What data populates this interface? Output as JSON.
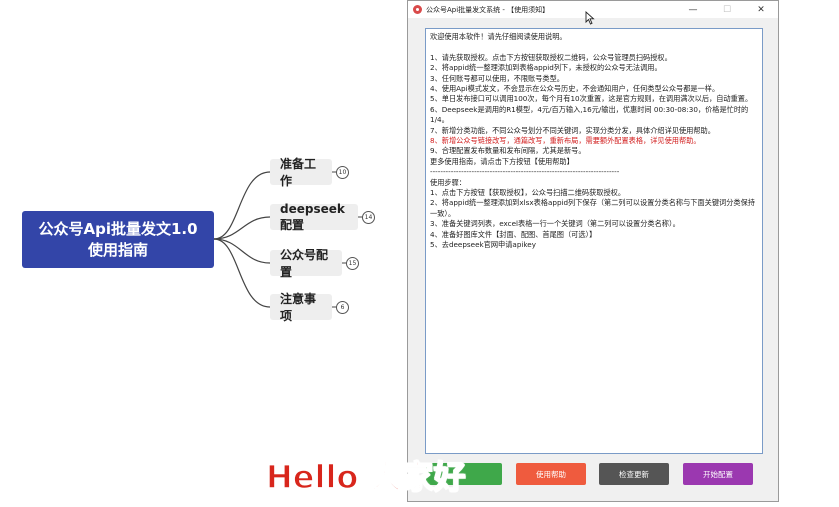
{
  "mindmap": {
    "root": {
      "line1": "公众号Api批量发文1.0",
      "line2": "使用指南"
    },
    "children": [
      {
        "label": "准备工作",
        "badge": "10"
      },
      {
        "label": "deepseek配置",
        "badge": "14"
      },
      {
        "label": "公众号配置",
        "badge": "15"
      },
      {
        "label": "注意事项",
        "badge": "6"
      }
    ],
    "colors": {
      "root": "#3345a8",
      "child": "#eeeeee"
    }
  },
  "window": {
    "title": "公众号Api批量发文系统 - 【使用须知】",
    "controls": {
      "minimize": "—",
      "maximize": "☐",
      "close": "✕"
    },
    "notice_lines": [
      {
        "text": "欢迎使用本软件！请先仔细阅读使用说明。"
      },
      {
        "text": ""
      },
      {
        "text": "1、请先获取授权。点击下方按钮获取授权二维码，公众号管理员扫码授权。"
      },
      {
        "text": "2、将appid统一整理添加到表格appid列下，未授权的公众号无法调用。"
      },
      {
        "text": "3、任何账号都可以使用，不限账号类型。"
      },
      {
        "text": "4、使用Api模式发文，不会显示在公众号历史，不会通知用户，任何类型公众号都是一样。"
      },
      {
        "text": "5、单日发布接口可以调用100次，每个月有10次重置，这是官方规则，在调用满次以后，自动重置。",
        "wrap": true
      },
      {
        "text": "6、Deepseek是调用的R1模型，4元/百万输入,16元/输出，优惠时间 00:30-08:30，价格是忙时的1/4。",
        "wrap": true
      },
      {
        "text": "7、新增分类功能，不同公众号划分不同关键词，实现分类分发，具体介绍详见使用帮助。"
      },
      {
        "text": "8、新增公众号链接改写，通篇改写，重新布局，需要额外配置表格，详见使用帮助。",
        "red": true
      },
      {
        "text": "9、合理配置发布数量和发布间隔，尤其是新号。"
      },
      {
        "text": "更多使用指南，请点击下方按钮【使用帮助】"
      },
      {
        "text": "-------------------------------------------------------------------------"
      },
      {
        "text": "使用步骤："
      },
      {
        "text": "1、点击下方按钮【获取授权】，公众号扫描二维码获取授权。"
      },
      {
        "text": "2、将appid统一整理添加到xlsx表格appid列下保存（第二列可以设置分类名称与下面关键词分类保持一致）。",
        "wrap": true
      },
      {
        "text": "3、准备关键词列表，excel表格一行一个关键词（第二列可以设置分类名称）。"
      },
      {
        "text": "4、准备好图库文件【封面、配图、首尾图（可选）】"
      },
      {
        "text": "5、去deepseek官网申请apikey"
      }
    ],
    "buttons": [
      {
        "label": "",
        "color": "#3fa84a"
      },
      {
        "label": "使用帮助",
        "color": "#ef5b3e"
      },
      {
        "label": "检查更新",
        "color": "#555555"
      },
      {
        "label": "开始配置",
        "color": "#9b38b0"
      }
    ]
  },
  "caption": "Hello 大家好"
}
